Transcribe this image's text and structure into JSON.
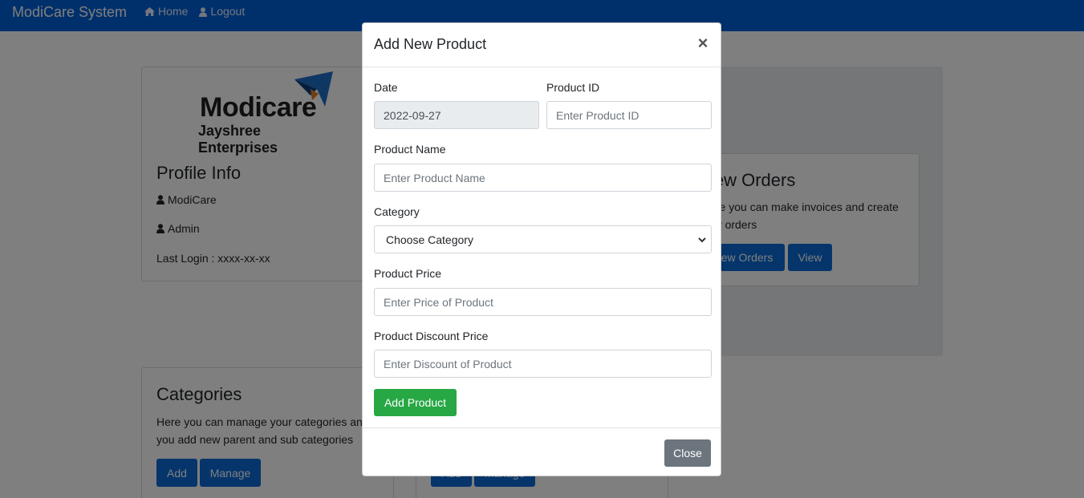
{
  "navbar": {
    "brand": "ModiCare System",
    "home_label": "Home",
    "logout_label": "Logout"
  },
  "profile": {
    "logo_line1": "Modicare",
    "logo_line2": "Jayshree Enterprises",
    "title": "Profile Info",
    "name": "ModiCare",
    "role": "Admin",
    "last_login": "Last Login : xxxx-xx-xx"
  },
  "orders": {
    "title": "New Orders",
    "description_line1": "Here you can make invoices and create",
    "description_line2": "new orders",
    "new_button": "New Orders",
    "view_button": "View"
  },
  "categories": {
    "title": "Categories",
    "description_line1": "Here you can manage your categories and",
    "description_line2": "you add new parent and sub categories",
    "add_button": "Add",
    "manage_button": "Manage"
  },
  "middle_card": {
    "add_button": "Add",
    "manage_button": "Manage"
  },
  "modal": {
    "title": "Add New Product",
    "close_symbol": "×",
    "date_label": "Date",
    "date_value": "2022-09-27",
    "product_id_label": "Product ID",
    "product_id_placeholder": "Enter Product ID",
    "product_name_label": "Product Name",
    "product_name_placeholder": "Enter Product Name",
    "category_label": "Category",
    "category_selected": "Choose Category",
    "price_label": "Product Price",
    "price_placeholder": "Enter Price of Product",
    "discount_label": "Product Discount Price",
    "discount_placeholder": "Enter Discount of Product",
    "add_button": "Add Product",
    "close_button": "Close"
  },
  "colors": {
    "navbar": "#0060d6",
    "primary": "#0b6bd6",
    "success": "#28a745",
    "secondary": "#6c757d"
  }
}
